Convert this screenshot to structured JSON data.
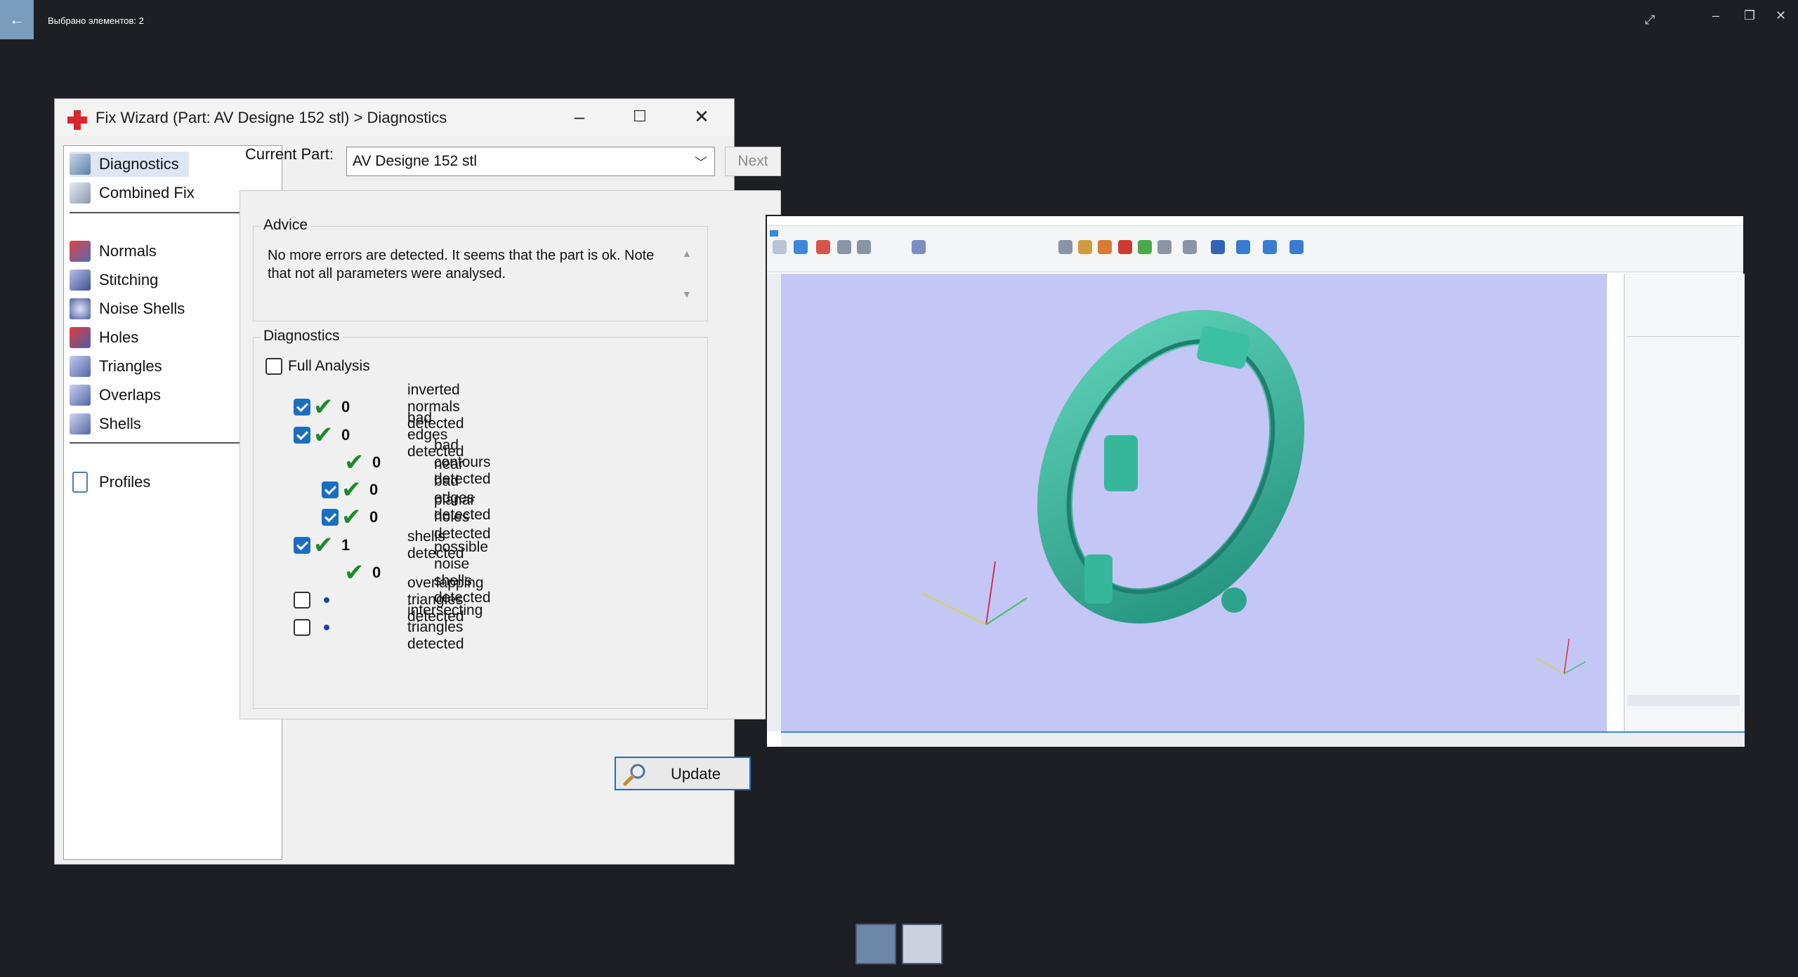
{
  "viewer": {
    "title": "Выбрано элементов: 2"
  },
  "wizard": {
    "title": "Fix Wizard (Part: AV Designe 152 stl) > Diagnostics",
    "nav": [
      {
        "label": "Diagnostics",
        "icon": "magnifier-icon",
        "selected": true
      },
      {
        "label": "Combined Fix",
        "icon": "combined-fix-icon"
      },
      {
        "label": "Normals",
        "icon": "normals-icon"
      },
      {
        "label": "Stitching",
        "icon": "stitching-icon"
      },
      {
        "label": "Noise Shells",
        "icon": "noise-shells-icon"
      },
      {
        "label": "Holes",
        "icon": "holes-icon"
      },
      {
        "label": "Triangles",
        "icon": "triangles-icon"
      },
      {
        "label": "Overlaps",
        "icon": "overlaps-icon"
      },
      {
        "label": "Shells",
        "icon": "shells-icon"
      },
      {
        "label": "Profiles",
        "icon": "profiles-icon"
      }
    ],
    "current_part_label": "Current Part:",
    "current_part_value": "AV Designe 152 stl",
    "next_label": "Next",
    "advice": {
      "legend": "Advice",
      "text": "No more errors are detected. It seems that the part is ok. Note that not all parameters were analysed."
    },
    "diagnostics": {
      "legend": "Diagnostics",
      "full_analysis": "Full Analysis",
      "rows": [
        {
          "checked": true,
          "ok": true,
          "count": "0",
          "label": "inverted normals detected"
        },
        {
          "checked": true,
          "ok": true,
          "count": "0",
          "label": "bad edges detected"
        },
        {
          "checked": null,
          "ok": true,
          "count": "0",
          "label": "bad contours detected"
        },
        {
          "checked": true,
          "ok": true,
          "count": "0",
          "label": "near bad edges detected"
        },
        {
          "checked": true,
          "ok": true,
          "count": "0",
          "label": "planar holes detected"
        },
        {
          "checked": true,
          "ok": true,
          "count": "1",
          "label": "shells detected"
        },
        {
          "checked": null,
          "ok": true,
          "count": "0",
          "label": "possible noise shells detected"
        },
        {
          "checked": false,
          "ok": false,
          "count": "",
          "label": "overlapping triangles detected"
        },
        {
          "checked": false,
          "ok": false,
          "count": "",
          "label": "intersecting triangles detected"
        }
      ]
    },
    "update_label": "Update"
  },
  "colors": {
    "accent": "#1a6ec0",
    "check": "#1d8a2a",
    "model": "#3bb79c",
    "viewport": "#c4c6f6"
  }
}
